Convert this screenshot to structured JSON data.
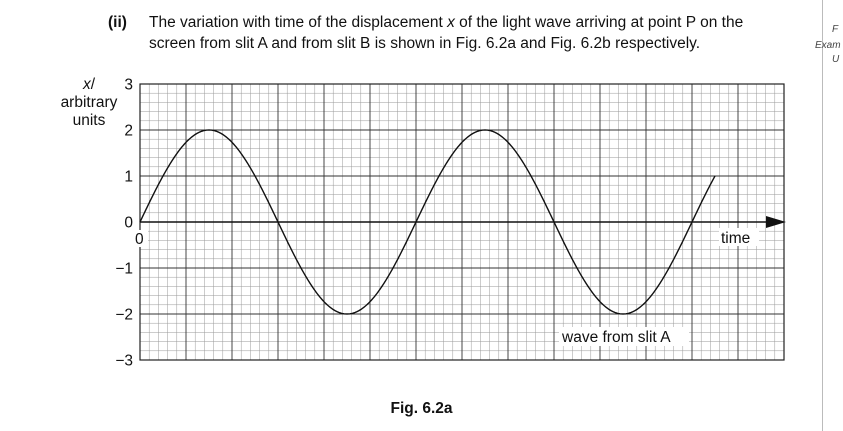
{
  "question": {
    "number": "(ii)",
    "line1_pre": "The variation with time of the displacement ",
    "line1_var": "x",
    "line1_post": " of the light wave arriving at point P on the",
    "line2": "screen from slit A and from slit B is shown in Fig. 6.2a and Fig. 6.2b respectively."
  },
  "margin": {
    "line1": "F",
    "line2": "Exam",
    "line3": "U"
  },
  "caption": "Fig. 6.2a",
  "chart_data": {
    "type": "line",
    "ylabel_var": "x",
    "ylabel_rest": "/",
    "ylabel_line2": "arbitrary",
    "ylabel_line3": "units",
    "xlabel": "time",
    "x_origin_label": "0",
    "ylim": [
      -3,
      3
    ],
    "yticks": [
      {
        "value": 3,
        "label": "3"
      },
      {
        "value": 2,
        "label": "2"
      },
      {
        "value": 1,
        "label": "1"
      },
      {
        "value": 0,
        "label": "0"
      },
      {
        "value": -1,
        "label": "−1"
      },
      {
        "value": -2,
        "label": "−2"
      },
      {
        "value": -3,
        "label": "−3"
      }
    ],
    "grid": true,
    "series": [
      {
        "name": "wave from slit A",
        "amplitude": 2,
        "period_major_divisions": 6,
        "extent_major_divisions": 12.5,
        "end_value": 1
      }
    ]
  }
}
